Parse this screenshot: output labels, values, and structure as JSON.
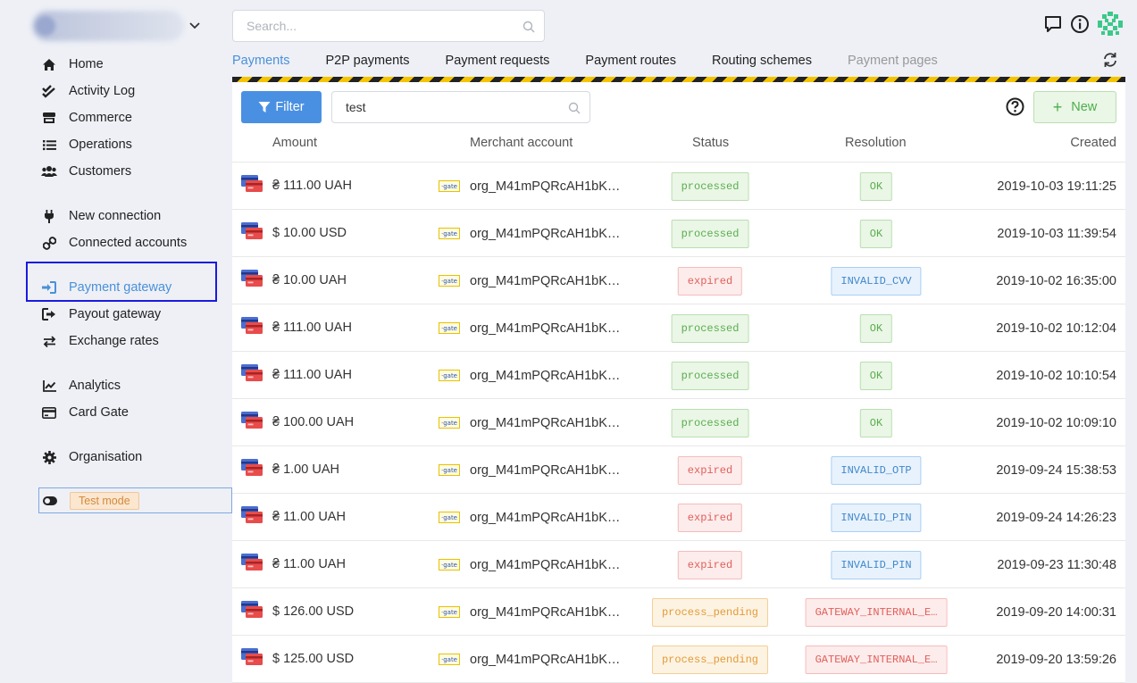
{
  "sidebar": {
    "items": [
      {
        "label": "Home",
        "icon": "home-icon",
        "key": "home"
      },
      {
        "label": "Activity Log",
        "icon": "check-double-icon",
        "key": "activity-log"
      },
      {
        "label": "Commerce",
        "icon": "store-icon",
        "key": "commerce"
      },
      {
        "label": "Operations",
        "icon": "list-icon",
        "key": "operations"
      },
      {
        "label": "Customers",
        "icon": "users-icon",
        "key": "customers"
      },
      {
        "label": "New connection",
        "icon": "plug-icon",
        "key": "new-connection"
      },
      {
        "label": "Connected accounts",
        "icon": "link-icon",
        "key": "connected-accounts"
      },
      {
        "label": "Payment gateway",
        "icon": "sign-in-icon",
        "key": "payment-gateway",
        "active": true
      },
      {
        "label": "Payout gateway",
        "icon": "sign-out-icon",
        "key": "payout-gateway"
      },
      {
        "label": "Exchange rates",
        "icon": "exchange-icon",
        "key": "exchange-rates"
      },
      {
        "label": "Analytics",
        "icon": "chart-line-icon",
        "key": "analytics"
      },
      {
        "label": "Card Gate",
        "icon": "credit-card-icon",
        "key": "card-gate"
      },
      {
        "label": "Organisation",
        "icon": "gear-icon",
        "key": "organisation"
      }
    ],
    "test_mode_label": "Test mode"
  },
  "search": {
    "placeholder": "Search..."
  },
  "tabs": [
    {
      "label": "Payments",
      "active": true
    },
    {
      "label": "P2P payments"
    },
    {
      "label": "Payment requests"
    },
    {
      "label": "Payment routes"
    },
    {
      "label": "Routing schemes"
    },
    {
      "label": "Payment pages",
      "disabled": true
    }
  ],
  "toolbar": {
    "filter_label": "Filter",
    "filter_value": "test",
    "new_label": "New"
  },
  "table": {
    "columns": {
      "amount": "Amount",
      "merchant": "Merchant account",
      "status": "Status",
      "resolution": "Resolution",
      "created": "Created"
    },
    "rows": [
      {
        "amount": "₴ 111.00 UAH",
        "merchant": "org_M41mPQRcAH1bK…",
        "status": "processed",
        "resolution": "OK",
        "created": "2019-10-03 19:11:25"
      },
      {
        "amount": "$ 10.00 USD",
        "merchant": "org_M41mPQRcAH1bK…",
        "status": "processed",
        "resolution": "OK",
        "created": "2019-10-03 11:39:54"
      },
      {
        "amount": "₴ 10.00 UAH",
        "merchant": "org_M41mPQRcAH1bK…",
        "status": "expired",
        "resolution": "INVALID_CVV",
        "created": "2019-10-02 16:35:00"
      },
      {
        "amount": "₴ 111.00 UAH",
        "merchant": "org_M41mPQRcAH1bK…",
        "status": "processed",
        "resolution": "OK",
        "created": "2019-10-02 10:12:04"
      },
      {
        "amount": "₴ 111.00 UAH",
        "merchant": "org_M41mPQRcAH1bK…",
        "status": "processed",
        "resolution": "OK",
        "created": "2019-10-02 10:10:54"
      },
      {
        "amount": "₴ 100.00 UAH",
        "merchant": "org_M41mPQRcAH1bK…",
        "status": "processed",
        "resolution": "OK",
        "created": "2019-10-02 10:09:10"
      },
      {
        "amount": "₴ 1.00 UAH",
        "merchant": "org_M41mPQRcAH1bK…",
        "status": "expired",
        "resolution": "INVALID_OTP",
        "created": "2019-09-24 15:38:53"
      },
      {
        "amount": "₴ 11.00 UAH",
        "merchant": "org_M41mPQRcAH1bK…",
        "status": "expired",
        "resolution": "INVALID_PIN",
        "created": "2019-09-24 14:26:23"
      },
      {
        "amount": "₴ 11.00 UAH",
        "merchant": "org_M41mPQRcAH1bK…",
        "status": "expired",
        "resolution": "INVALID_PIN",
        "created": "2019-09-23 11:30:48"
      },
      {
        "amount": "$ 126.00 USD",
        "merchant": "org_M41mPQRcAH1bK…",
        "status": "process_pending",
        "resolution": "GATEWAY_INTERNAL_E…",
        "created": "2019-09-20 14:00:31"
      },
      {
        "amount": "$ 125.00 USD",
        "merchant": "org_M41mPQRcAH1bK…",
        "status": "process_pending",
        "resolution": "GATEWAY_INTERNAL_E…",
        "created": "2019-09-20 13:59:26"
      }
    ]
  },
  "colors": {
    "accent": "#4a90e2",
    "active_nav": "#4a90d9",
    "highlight_box": "#1a1adf",
    "processed": "#5aae4f",
    "expired": "#e0605a",
    "info": "#3f87c9",
    "pending": "#e39b37"
  }
}
